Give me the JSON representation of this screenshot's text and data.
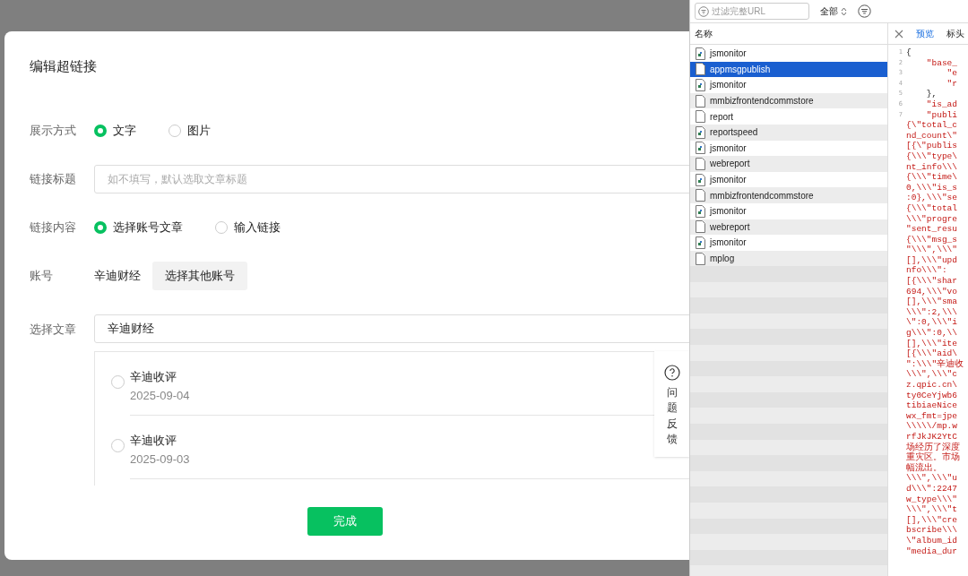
{
  "dialog": {
    "title": "编辑超链接",
    "display_mode": {
      "label": "展示方式",
      "options": [
        {
          "label": "文字",
          "selected": true
        },
        {
          "label": "图片",
          "selected": false
        }
      ]
    },
    "link_title": {
      "label": "链接标题",
      "placeholder": "如不填写，默认选取文章标题"
    },
    "link_content": {
      "label": "链接内容",
      "options": [
        {
          "label": "选择账号文章",
          "selected": true
        },
        {
          "label": "输入链接",
          "selected": false
        }
      ]
    },
    "account": {
      "label": "账号",
      "name": "辛迪财经",
      "button": "选择其他账号"
    },
    "article": {
      "label": "选择文章",
      "search_value": "辛迪财经",
      "articles": [
        {
          "title": "辛迪收评",
          "date": "2025-09-04",
          "selected": false
        },
        {
          "title": "辛迪收评",
          "date": "2025-09-03",
          "selected": false
        }
      ]
    },
    "feedback": "问题反馈",
    "done_button": "完成"
  },
  "devtools": {
    "filter_placeholder": "过滤完整URL",
    "type_filter": "全部",
    "column_header": "名称",
    "requests": [
      {
        "name": "jsmonitor",
        "kind": "script",
        "selected": false
      },
      {
        "name": "appmsgpublish",
        "kind": "document",
        "selected": true
      },
      {
        "name": "jsmonitor",
        "kind": "script",
        "selected": false
      },
      {
        "name": "mmbizfrontendcommstore",
        "kind": "document",
        "selected": false
      },
      {
        "name": "report",
        "kind": "document",
        "selected": false
      },
      {
        "name": "reportspeed",
        "kind": "script",
        "selected": false
      },
      {
        "name": "jsmonitor",
        "kind": "script",
        "selected": false
      },
      {
        "name": "webreport",
        "kind": "document",
        "selected": false
      },
      {
        "name": "jsmonitor",
        "kind": "script",
        "selected": false
      },
      {
        "name": "mmbizfrontendcommstore",
        "kind": "document",
        "selected": false
      },
      {
        "name": "jsmonitor",
        "kind": "script",
        "selected": false
      },
      {
        "name": "webreport",
        "kind": "document",
        "selected": false
      },
      {
        "name": "jsmonitor",
        "kind": "script",
        "selected": false
      },
      {
        "name": "mplog",
        "kind": "document",
        "selected": false
      }
    ],
    "tabs": [
      {
        "label": "预览",
        "selected": true
      },
      {
        "label": "标头",
        "selected": false
      }
    ],
    "preview_lines": [
      {
        "number": "1",
        "text": "{",
        "kind": "key"
      },
      {
        "number": "2",
        "text": "    \"base_",
        "kind": "string"
      },
      {
        "number": "3",
        "text": "        \"e",
        "kind": "string"
      },
      {
        "number": "4",
        "text": "        \"r",
        "kind": "string"
      },
      {
        "number": "5",
        "text": "    },",
        "kind": "key"
      },
      {
        "number": "6",
        "text": "    \"is_ad",
        "kind": "string"
      },
      {
        "number": "7",
        "text": "    \"publi",
        "kind": "string"
      },
      {
        "text": "{\\\"total_c",
        "kind": "string"
      },
      {
        "text": "nd_count\\\"",
        "kind": "string"
      },
      {
        "text": "[{\\\"publis",
        "kind": "string"
      },
      {
        "text": "{\\\\\\\"type\\",
        "kind": "string"
      },
      {
        "text": "nt_info\\\\\\",
        "kind": "string"
      },
      {
        "text": "{\\\\\\\"time\\",
        "kind": "string"
      },
      {
        "text": "0,\\\\\\\"is_s",
        "kind": "string"
      },
      {
        "text": ":0},\\\\\\\"se",
        "kind": "string"
      },
      {
        "text": "{\\\\\\\"total",
        "kind": "string"
      },
      {
        "text": "\\\\\\\"progre",
        "kind": "string"
      },
      {
        "text": "\"sent_resu",
        "kind": "string"
      },
      {
        "text": "{\\\\\\\"msg_s",
        "kind": "string"
      },
      {
        "text": "\"\\\\\\\",\\\\\\\"",
        "kind": "string"
      },
      {
        "text": "[],\\\\\\\"upd",
        "kind": "string"
      },
      {
        "text": "nfo\\\\\\\":",
        "kind": "string"
      },
      {
        "text": "[{\\\\\\\"shar",
        "kind": "string"
      },
      {
        "text": "694,\\\\\\\"vo",
        "kind": "string"
      },
      {
        "text": "[],\\\\\\\"sma",
        "kind": "string"
      },
      {
        "text": "\\\\\\\":2,\\\\\\",
        "kind": "string"
      },
      {
        "text": "\\\":0,\\\\\\\"i",
        "kind": "string"
      },
      {
        "text": "g\\\\\\\":0,\\\\",
        "kind": "string"
      },
      {
        "text": "[],\\\\\\\"ite",
        "kind": "string"
      },
      {
        "text": "[{\\\\\\\"aid\\",
        "kind": "string"
      },
      {
        "text": "\":\\\\\\\"辛迪收",
        "kind": "string"
      },
      {
        "text": "\\\\\\\",\\\\\\\"c",
        "kind": "string"
      },
      {
        "text": "z.qpic.cn\\",
        "kind": "string"
      },
      {
        "text": "ty0CeYjwb6",
        "kind": "string"
      },
      {
        "text": "tibiaeNice",
        "kind": "string"
      },
      {
        "text": "wx_fmt=jpe",
        "kind": "string"
      },
      {
        "text": "\\\\\\\\\\/mp.w",
        "kind": "string"
      },
      {
        "text": "rfJkJK2YtC",
        "kind": "string"
      },
      {
        "text": "场经历了深度",
        "kind": "string"
      },
      {
        "text": "重灾区。市场",
        "kind": "string"
      },
      {
        "text": "幅流出。",
        "kind": "string"
      },
      {
        "text": "\\\\\\\",\\\\\\\"u",
        "kind": "string"
      },
      {
        "text": "d\\\\\\\":2247",
        "kind": "string"
      },
      {
        "text": "w_type\\\\\\\"",
        "kind": "string"
      },
      {
        "text": "\\\\\\\",\\\\\\\"t",
        "kind": "string"
      },
      {
        "text": "[],\\\\\\\"cre",
        "kind": "string"
      },
      {
        "text": "bscribe\\\\\\",
        "kind": "string"
      },
      {
        "text": "\\\"album_id",
        "kind": "string"
      },
      {
        "text": "\"media_dur",
        "kind": "string"
      }
    ]
  }
}
